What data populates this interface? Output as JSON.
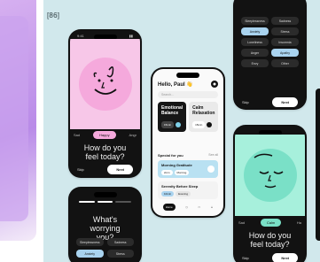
{
  "project_tag": "[86]",
  "colors": {
    "panel_bg": "#d1e8ec",
    "accent_blue": "#a9d3ef",
    "mint": "#7ae0c7",
    "pink": "#f5a9dc"
  },
  "phone1": {
    "status_time": "9:41",
    "moods": [
      "Sad",
      "Happy",
      "Angr"
    ],
    "question": "How do you feel today?",
    "skip": "Skip",
    "next": "Next"
  },
  "phone2": {
    "question": "What's worrying you?",
    "options": [
      "Sleeplessness",
      "Sadness",
      "Anxiety",
      "Stress"
    ]
  },
  "phone3": {
    "greeting": "Hello, Paul 👋",
    "search_placeholder": "Search...",
    "cards": [
      {
        "title": "Emotional Balance",
        "meta": "15min"
      },
      {
        "title": "Calm Relaxation",
        "meta": "15min"
      }
    ],
    "section_title": "Special for you",
    "section_link": "See all",
    "recs": [
      {
        "title": "Morning Gratitude",
        "tags": [
          "2min",
          "Morning"
        ]
      },
      {
        "title": "Serenity Before Sleep",
        "tags": [
          "10min",
          "Evening"
        ]
      }
    ],
    "tabs": [
      "Home",
      "",
      "",
      ""
    ]
  },
  "phone4": {
    "options": [
      "Sleeplessness",
      "Sadness",
      "Anxiety",
      "Stress",
      "Loneliness",
      "Insomnia",
      "Anger",
      "Apathy",
      "Envy",
      "Other"
    ],
    "selected": [
      "Anxiety",
      "Apathy"
    ],
    "skip": "Skip",
    "next": "Next"
  },
  "phone5": {
    "moods": [
      "Sad",
      "Calm",
      "Ha"
    ],
    "question": "How do you feel today?",
    "skip": "Skip",
    "next": "Next"
  }
}
